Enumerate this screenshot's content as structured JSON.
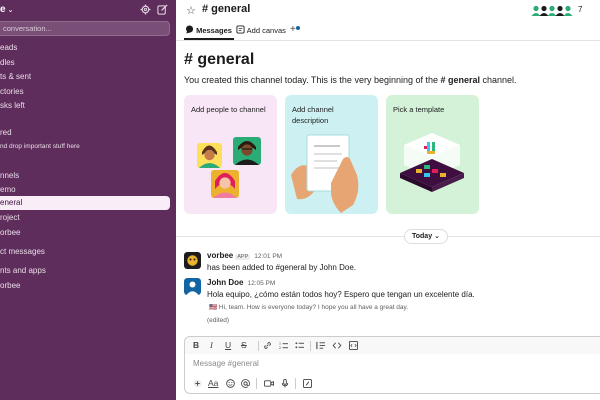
{
  "workspace": {
    "name": "e",
    "chevron": "chevron-down-icon"
  },
  "sidebar": {
    "search_placeholder": "conversation...",
    "items": [
      {
        "label": "eads"
      },
      {
        "label": "dles"
      },
      {
        "label": "ts & sent"
      },
      {
        "label": "ctories"
      },
      {
        "label": "sks left"
      },
      {
        "label": "red"
      },
      {
        "label": "nd drop important stuff here"
      },
      {
        "label": "nnels"
      },
      {
        "label": "emo"
      },
      {
        "label": "eneral"
      },
      {
        "label": "roject"
      },
      {
        "label": "orbee"
      },
      {
        "label": "ct messages"
      },
      {
        "label": "nts and apps"
      },
      {
        "label": "orbee"
      }
    ]
  },
  "header": {
    "channel_title": "# general",
    "member_count": "7"
  },
  "tabs": [
    {
      "label": "Messages"
    },
    {
      "label": "Add canvas"
    }
  ],
  "channel": {
    "big_title": "# general",
    "intro_prefix": "You created this channel today. This is the very beginning of the ",
    "intro_channel": "# general",
    "intro_suffix": " channel."
  },
  "cards": [
    {
      "label": "Add people to channel",
      "bg": "#f8e6f6"
    },
    {
      "label": "Add channel description",
      "bg": "#cdf1f2"
    },
    {
      "label": "Pick a template",
      "bg": "#d3f2d8"
    }
  ],
  "divider": {
    "label": "Today",
    "chevron": "chevron-down-icon"
  },
  "messages": [
    {
      "author": "vorbee",
      "badge": "APP",
      "time": "12:01 PM",
      "text": "has been added to #general by John Doe."
    },
    {
      "author": "John Doe",
      "time": "12:05 PM",
      "text": "Hola equipo, ¿cómo están todos hoy? Espero que tengan un excelente día.",
      "translation": "🇺🇸 Hi, team. How is everyone today? I hope you all have a great day.",
      "edited": "(edited)"
    }
  ],
  "composer": {
    "placeholder": "Message #general",
    "format_labels": [
      "B",
      "I",
      "U",
      "S"
    ],
    "text_icon": "Aa"
  },
  "colors": {
    "sidebar_bg": "#5f2d5c",
    "active_item_bg": "#f9edf7",
    "accent_blue": "#1264a3"
  }
}
